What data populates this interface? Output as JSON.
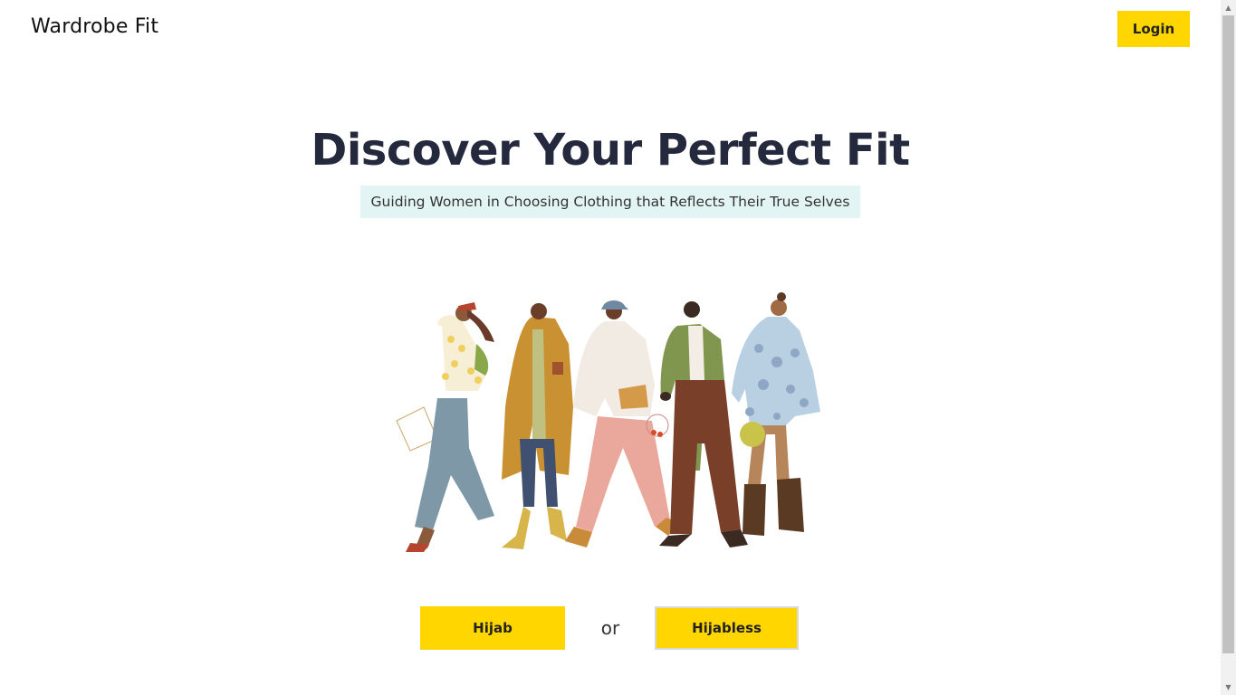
{
  "header": {
    "brand": "Wardrobe Fit",
    "login_label": "Login"
  },
  "hero": {
    "title": "Discover Your Perfect Fit",
    "subtitle": "Guiding Women in Choosing Clothing that Reflects Their True Selves"
  },
  "illustration": {
    "icon": "women-group-illustration"
  },
  "choices": {
    "hijab_label": "Hijab",
    "separator": "or",
    "hijabless_label": "Hijabless"
  },
  "colors": {
    "accent": "#FFD600",
    "title": "#24293e",
    "subtitle_bg": "#e3f4f4"
  }
}
